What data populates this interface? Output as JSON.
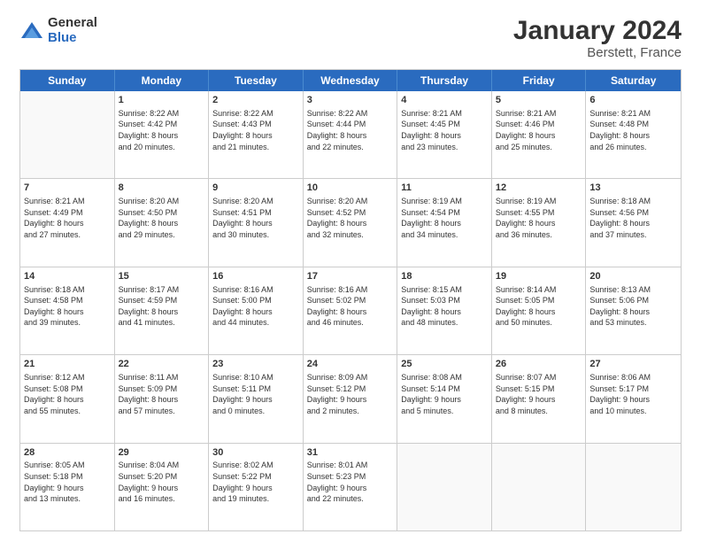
{
  "logo": {
    "general": "General",
    "blue": "Blue"
  },
  "title": {
    "month": "January 2024",
    "location": "Berstett, France"
  },
  "header_days": [
    "Sunday",
    "Monday",
    "Tuesday",
    "Wednesday",
    "Thursday",
    "Friday",
    "Saturday"
  ],
  "weeks": [
    [
      {
        "day": "",
        "info": ""
      },
      {
        "day": "1",
        "info": "Sunrise: 8:22 AM\nSunset: 4:42 PM\nDaylight: 8 hours\nand 20 minutes."
      },
      {
        "day": "2",
        "info": "Sunrise: 8:22 AM\nSunset: 4:43 PM\nDaylight: 8 hours\nand 21 minutes."
      },
      {
        "day": "3",
        "info": "Sunrise: 8:22 AM\nSunset: 4:44 PM\nDaylight: 8 hours\nand 22 minutes."
      },
      {
        "day": "4",
        "info": "Sunrise: 8:21 AM\nSunset: 4:45 PM\nDaylight: 8 hours\nand 23 minutes."
      },
      {
        "day": "5",
        "info": "Sunrise: 8:21 AM\nSunset: 4:46 PM\nDaylight: 8 hours\nand 25 minutes."
      },
      {
        "day": "6",
        "info": "Sunrise: 8:21 AM\nSunset: 4:48 PM\nDaylight: 8 hours\nand 26 minutes."
      }
    ],
    [
      {
        "day": "7",
        "info": "Sunrise: 8:21 AM\nSunset: 4:49 PM\nDaylight: 8 hours\nand 27 minutes."
      },
      {
        "day": "8",
        "info": "Sunrise: 8:20 AM\nSunset: 4:50 PM\nDaylight: 8 hours\nand 29 minutes."
      },
      {
        "day": "9",
        "info": "Sunrise: 8:20 AM\nSunset: 4:51 PM\nDaylight: 8 hours\nand 30 minutes."
      },
      {
        "day": "10",
        "info": "Sunrise: 8:20 AM\nSunset: 4:52 PM\nDaylight: 8 hours\nand 32 minutes."
      },
      {
        "day": "11",
        "info": "Sunrise: 8:19 AM\nSunset: 4:54 PM\nDaylight: 8 hours\nand 34 minutes."
      },
      {
        "day": "12",
        "info": "Sunrise: 8:19 AM\nSunset: 4:55 PM\nDaylight: 8 hours\nand 36 minutes."
      },
      {
        "day": "13",
        "info": "Sunrise: 8:18 AM\nSunset: 4:56 PM\nDaylight: 8 hours\nand 37 minutes."
      }
    ],
    [
      {
        "day": "14",
        "info": "Sunrise: 8:18 AM\nSunset: 4:58 PM\nDaylight: 8 hours\nand 39 minutes."
      },
      {
        "day": "15",
        "info": "Sunrise: 8:17 AM\nSunset: 4:59 PM\nDaylight: 8 hours\nand 41 minutes."
      },
      {
        "day": "16",
        "info": "Sunrise: 8:16 AM\nSunset: 5:00 PM\nDaylight: 8 hours\nand 44 minutes."
      },
      {
        "day": "17",
        "info": "Sunrise: 8:16 AM\nSunset: 5:02 PM\nDaylight: 8 hours\nand 46 minutes."
      },
      {
        "day": "18",
        "info": "Sunrise: 8:15 AM\nSunset: 5:03 PM\nDaylight: 8 hours\nand 48 minutes."
      },
      {
        "day": "19",
        "info": "Sunrise: 8:14 AM\nSunset: 5:05 PM\nDaylight: 8 hours\nand 50 minutes."
      },
      {
        "day": "20",
        "info": "Sunrise: 8:13 AM\nSunset: 5:06 PM\nDaylight: 8 hours\nand 53 minutes."
      }
    ],
    [
      {
        "day": "21",
        "info": "Sunrise: 8:12 AM\nSunset: 5:08 PM\nDaylight: 8 hours\nand 55 minutes."
      },
      {
        "day": "22",
        "info": "Sunrise: 8:11 AM\nSunset: 5:09 PM\nDaylight: 8 hours\nand 57 minutes."
      },
      {
        "day": "23",
        "info": "Sunrise: 8:10 AM\nSunset: 5:11 PM\nDaylight: 9 hours\nand 0 minutes."
      },
      {
        "day": "24",
        "info": "Sunrise: 8:09 AM\nSunset: 5:12 PM\nDaylight: 9 hours\nand 2 minutes."
      },
      {
        "day": "25",
        "info": "Sunrise: 8:08 AM\nSunset: 5:14 PM\nDaylight: 9 hours\nand 5 minutes."
      },
      {
        "day": "26",
        "info": "Sunrise: 8:07 AM\nSunset: 5:15 PM\nDaylight: 9 hours\nand 8 minutes."
      },
      {
        "day": "27",
        "info": "Sunrise: 8:06 AM\nSunset: 5:17 PM\nDaylight: 9 hours\nand 10 minutes."
      }
    ],
    [
      {
        "day": "28",
        "info": "Sunrise: 8:05 AM\nSunset: 5:18 PM\nDaylight: 9 hours\nand 13 minutes."
      },
      {
        "day": "29",
        "info": "Sunrise: 8:04 AM\nSunset: 5:20 PM\nDaylight: 9 hours\nand 16 minutes."
      },
      {
        "day": "30",
        "info": "Sunrise: 8:02 AM\nSunset: 5:22 PM\nDaylight: 9 hours\nand 19 minutes."
      },
      {
        "day": "31",
        "info": "Sunrise: 8:01 AM\nSunset: 5:23 PM\nDaylight: 9 hours\nand 22 minutes."
      },
      {
        "day": "",
        "info": ""
      },
      {
        "day": "",
        "info": ""
      },
      {
        "day": "",
        "info": ""
      }
    ]
  ]
}
